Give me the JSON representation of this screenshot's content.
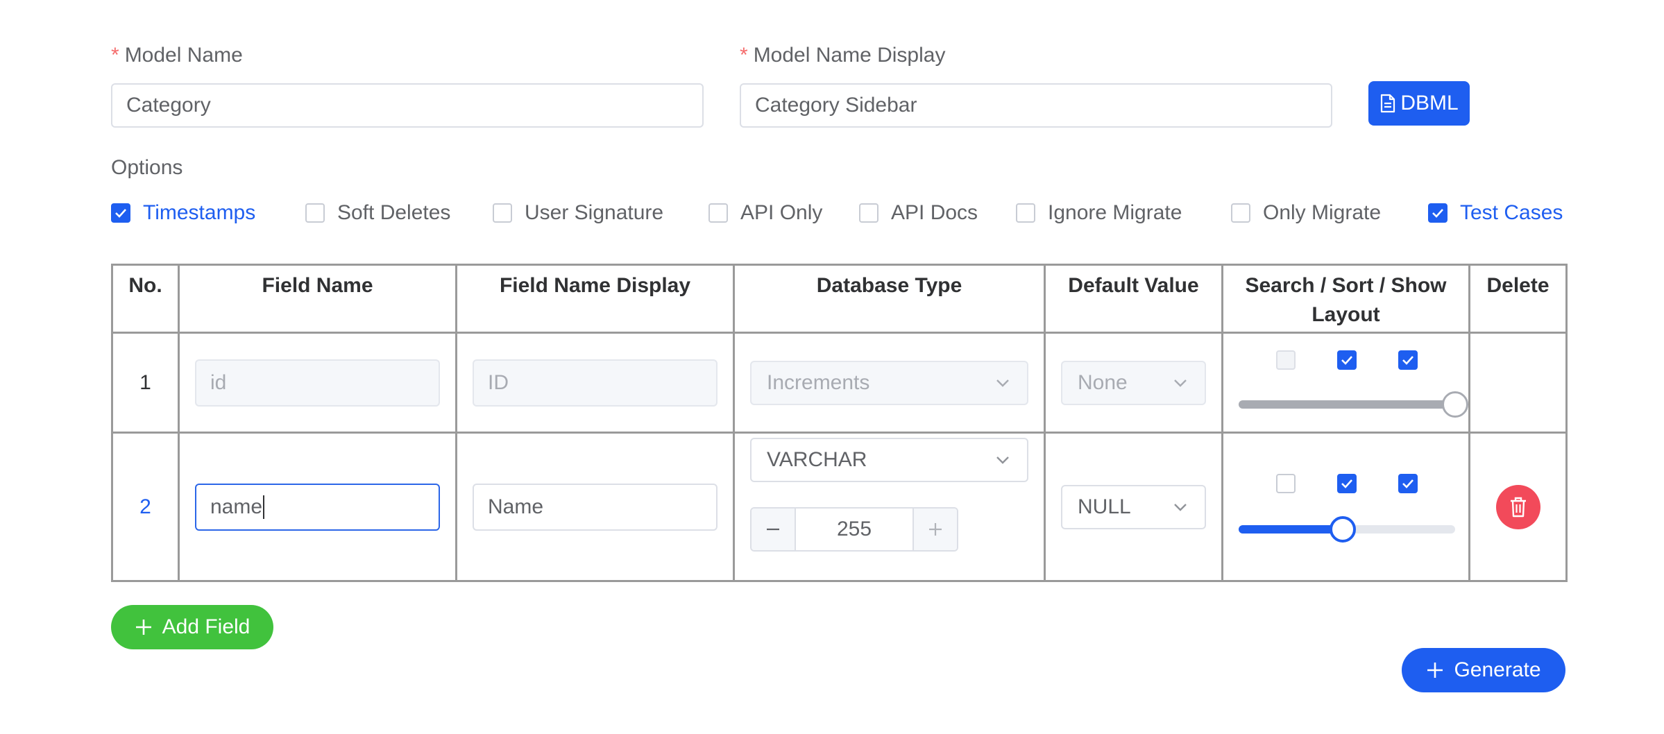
{
  "form": {
    "model_name": {
      "label": "Model Name",
      "required_mark": "*",
      "value": "Category"
    },
    "model_name_display": {
      "label": "Model Name Display",
      "required_mark": "*",
      "value": "Category Sidebar"
    },
    "dbml_button": {
      "label": "DBML",
      "icon": "document-icon"
    }
  },
  "options": {
    "title": "Options",
    "items": [
      {
        "label": "Timestamps",
        "checked": true
      },
      {
        "label": "Soft Deletes",
        "checked": false
      },
      {
        "label": "User Signature",
        "checked": false
      },
      {
        "label": "API Only",
        "checked": false
      },
      {
        "label": "API Docs",
        "checked": false
      },
      {
        "label": "Ignore Migrate",
        "checked": false
      },
      {
        "label": "Only Migrate",
        "checked": false
      },
      {
        "label": "Test Cases",
        "checked": true
      }
    ]
  },
  "table": {
    "headers": [
      "No.",
      "Field Name",
      "Field Name Display",
      "Database Type",
      "Default Value",
      "Search / Sort / Show",
      "Layout",
      "Delete"
    ],
    "rows": [
      {
        "no": "1",
        "field_name": "id",
        "field_name_display": "ID",
        "database_type": "Increments",
        "default_value": "None",
        "disabled": true,
        "search": false,
        "sort": true,
        "show": true,
        "layout_fraction": 1.0
      },
      {
        "no": "2",
        "field_name": "name",
        "field_name_display": "Name",
        "database_type": "VARCHAR",
        "length": "255",
        "default_value": "NULL",
        "disabled": false,
        "search": false,
        "sort": true,
        "show": true,
        "layout_fraction": 0.48
      }
    ]
  },
  "actions": {
    "add_field": "Add Field",
    "generate": "Generate"
  },
  "colors": {
    "primary": "#1e5ef0",
    "success": "#41c23d",
    "danger": "#f24a5a",
    "required": "#f56c6c"
  }
}
